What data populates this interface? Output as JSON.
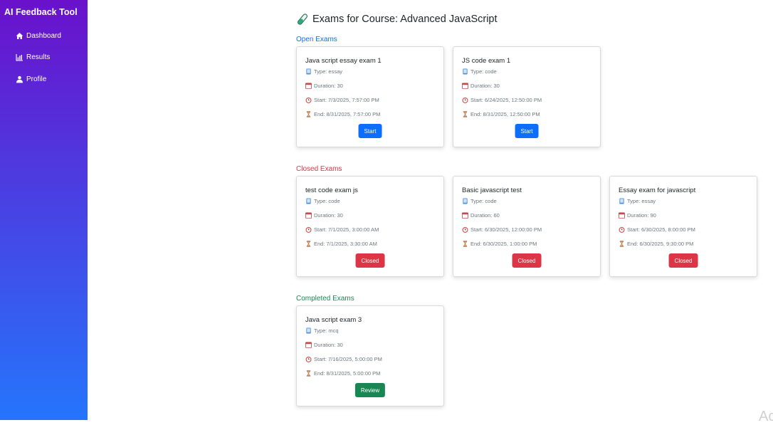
{
  "app": {
    "brand": "AI Feedback Tool"
  },
  "sidebar": {
    "items": [
      {
        "label": "Dashboard",
        "icon": "home-icon"
      },
      {
        "label": "Results",
        "icon": "chart-icon"
      },
      {
        "label": "Profile",
        "icon": "user-icon"
      }
    ]
  },
  "page": {
    "title": "Exams for Course: Advanced JavaScript",
    "title_icon": "test-tube-icon"
  },
  "sections": {
    "open": {
      "title": "Open Exams",
      "color": "#0d6efd",
      "exams": [
        {
          "name": "Java script essay exam 1",
          "type": "Type: essay",
          "duration": "Duration: 30",
          "start": "Start: 7/3/2025, 7:57:00 PM",
          "end": "End: 8/31/2025, 7:57:00 PM",
          "button": "Start"
        },
        {
          "name": "JS code exam 1",
          "type": "Type: code",
          "duration": "Duration: 30",
          "start": "Start: 6/24/2025, 12:50:00 PM",
          "end": "End: 8/31/2025, 12:50:00 PM",
          "button": "Start"
        }
      ]
    },
    "closed": {
      "title": "Closed Exams",
      "color": "#dc3545",
      "exams": [
        {
          "name": "test code exam js",
          "type": "Type: code",
          "duration": "Duration: 30",
          "start": "Start: 7/1/2025, 3:00:00 AM",
          "end": "End: 7/1/2025, 3:30:00 AM",
          "button": "Closed"
        },
        {
          "name": "Basic javascript test",
          "type": "Type: code",
          "duration": "Duration: 60",
          "start": "Start: 6/30/2025, 12:00:00 PM",
          "end": "End: 6/30/2025, 1:00:00 PM",
          "button": "Closed"
        },
        {
          "name": "Essay exam for javascript",
          "type": "Type: essay",
          "duration": "Duration: 90",
          "start": "Start: 6/30/2025, 8:00:00 PM",
          "end": "End: 6/30/2025, 9:30:00 PM",
          "button": "Closed"
        }
      ]
    },
    "completed": {
      "title": "Completed Exams",
      "color": "#198754",
      "exams": [
        {
          "name": "Java script exam 3",
          "type": "Type: mcq",
          "duration": "Duration: 30",
          "start": "Start: 7/16/2025, 5:00:00 PM",
          "end": "End: 8/31/2025, 5:00:00 PM",
          "button": "Review"
        }
      ]
    }
  },
  "icons": {
    "type": "book-icon",
    "duration": "calendar-icon",
    "start": "alarm-clock-icon",
    "end": "hourglass-icon"
  },
  "corner_text": "Ac"
}
